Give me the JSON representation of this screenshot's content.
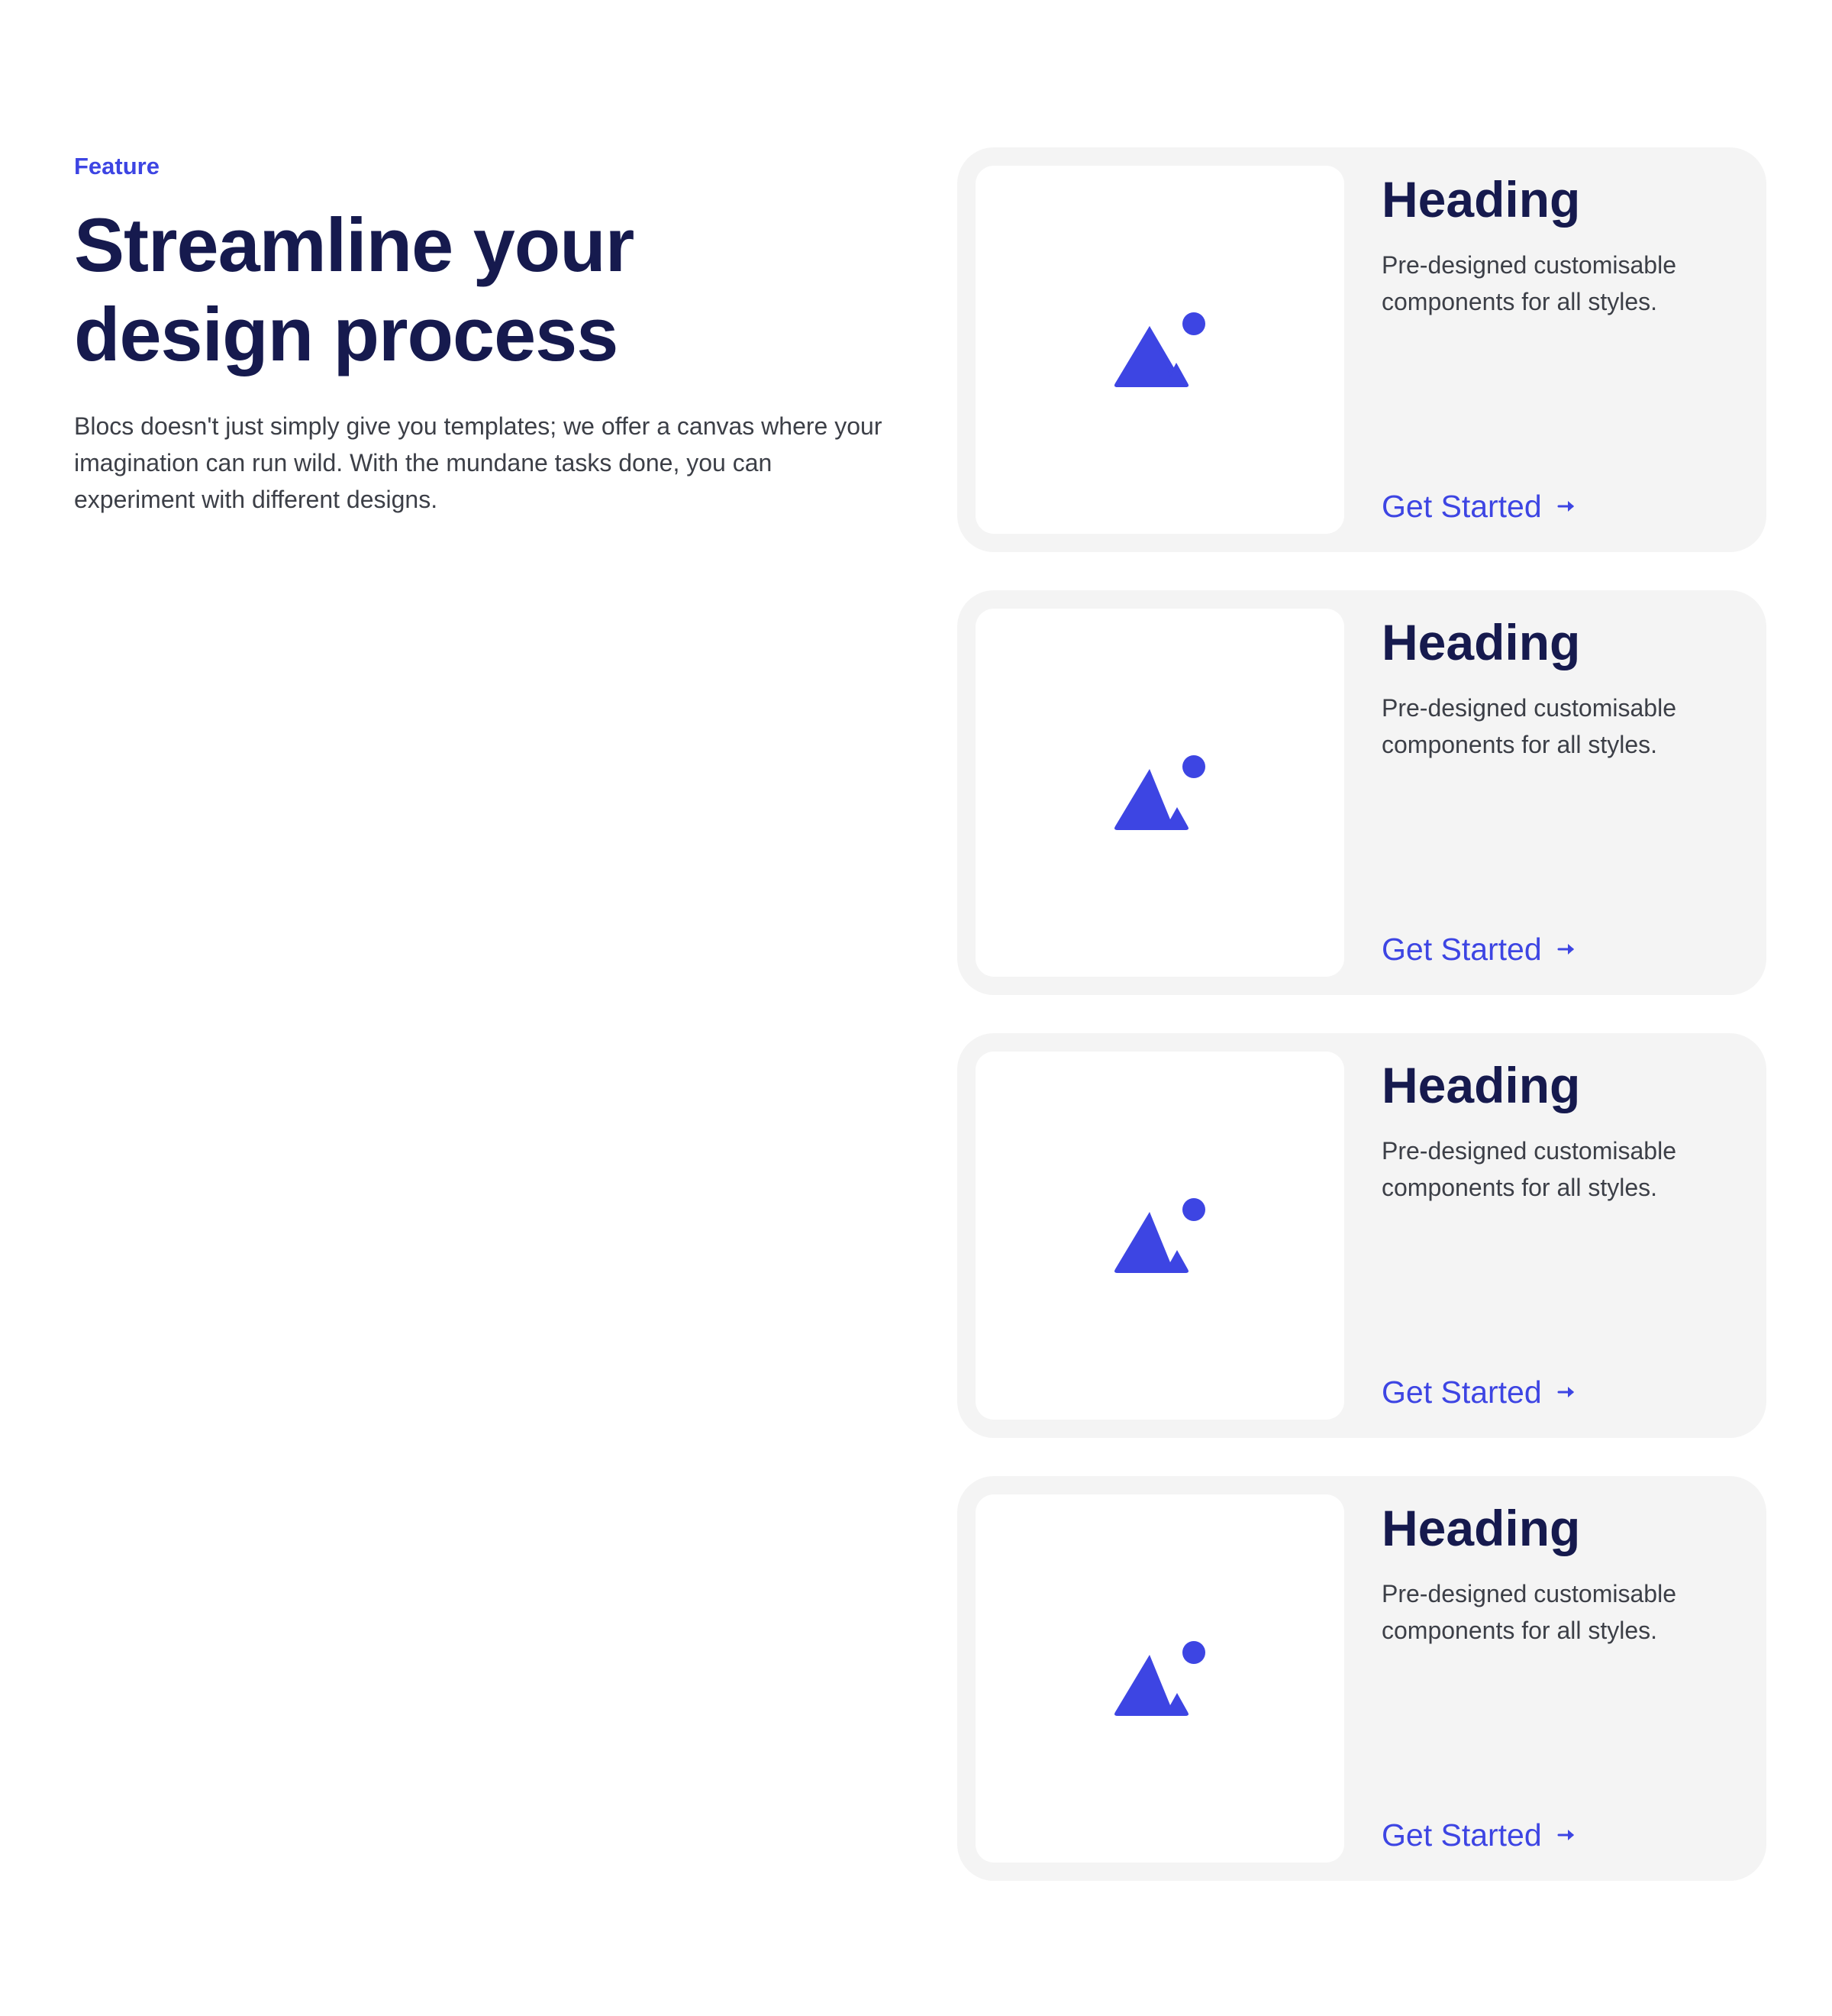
{
  "intro": {
    "eyebrow": "Feature",
    "title": "Streamline your design process",
    "lead": "Blocs doesn't just simply give you templates; we offer a canvas where your imagination can run wild. With the mundane tasks done, you can experiment with different designs."
  },
  "cards": [
    {
      "heading": "Heading",
      "text": "Pre-designed customisable components for all styles.",
      "link_label": "Get Started",
      "image_icon": "image-placeholder-icon",
      "link_icon": "arrow-right-icon"
    },
    {
      "heading": "Heading",
      "text": "Pre-designed customisable components for all styles.",
      "link_label": "Get Started",
      "image_icon": "image-placeholder-icon",
      "link_icon": "arrow-right-icon"
    },
    {
      "heading": "Heading",
      "text": "Pre-designed customisable components for all styles.",
      "link_label": "Get Started",
      "image_icon": "image-placeholder-icon",
      "link_icon": "arrow-right-icon"
    },
    {
      "heading": "Heading",
      "text": "Pre-designed customisable components for all styles.",
      "link_label": "Get Started",
      "image_icon": "image-placeholder-icon",
      "link_icon": "arrow-right-icon"
    }
  ],
  "colors": {
    "accent": "#3d45e3",
    "heading": "#161a4e",
    "body_text": "#3c3f47",
    "card_background": "#f4f4f4",
    "page_background": "#ffffff"
  }
}
